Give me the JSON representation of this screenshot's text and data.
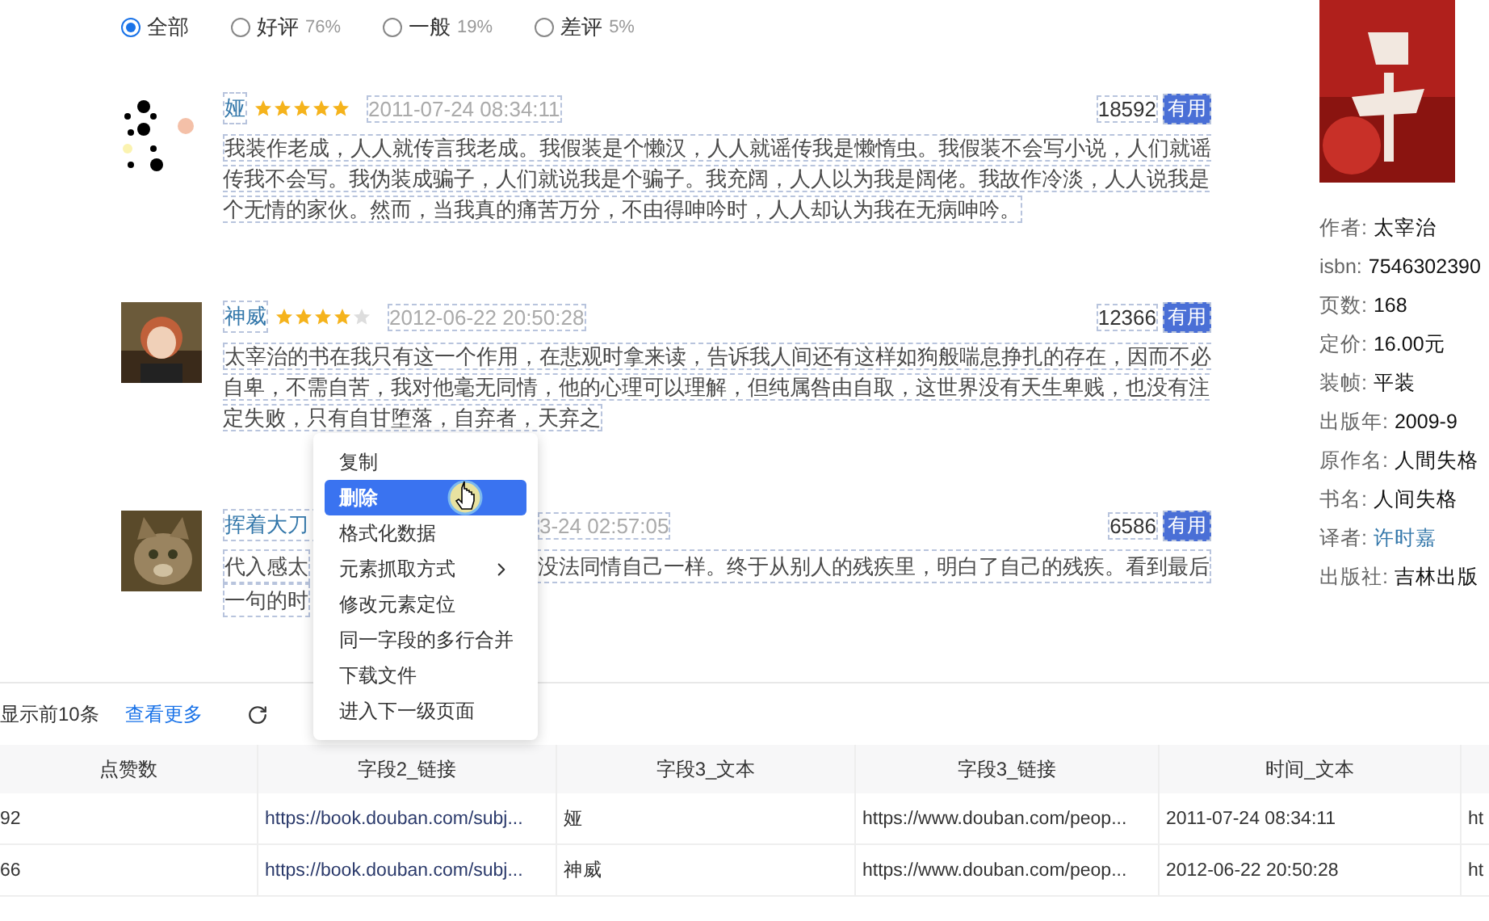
{
  "filter": [
    {
      "label": "全部",
      "selected": true
    },
    {
      "label": "好评",
      "share": "76%",
      "selected": false
    },
    {
      "label": "一般",
      "share": "19%",
      "selected": false
    },
    {
      "label": "差评",
      "share": "5%",
      "selected": false
    }
  ],
  "reviews": [
    {
      "kind": "full",
      "user": "娅",
      "stars": 5,
      "date": "2011-07-24 08:34:11",
      "useful_count": "18592",
      "useful_label": "有用",
      "text": "我装作老成，人人就传言我老成。我假装是个懒汉，人人就谣传我是懒惰虫。我假装不会写小说，人们就谣传我不会写。我伪装成骗子，人们就说我是个骗子。我充阔，人人以为我是阔佬。我故作冷淡，人人说我是个无情的家伙。然而，当我真的痛苦万分，不由得呻吟时，人人却认为我在无病呻吟。"
    },
    {
      "kind": "full",
      "user": "神威",
      "stars": 4,
      "date": "2012-06-22 20:50:28",
      "useful_count": "12366",
      "useful_label": "有用",
      "text": "太宰治的书在我只有这一个作用，在悲观时拿来读，告诉我人间还有这样如狗般喘息挣扎的存在，因而不必自卑，不需自苦，我对他毫无同情，他的心理可以理解，但纯属咎由自取，这世界没有天生卑贱，也没有注定失败，只有自甘堕落，自弃者，天弃之"
    },
    {
      "kind": "covered",
      "user": "挥着大刀",
      "date": "3-24 02:57:05",
      "useful_count": "6586",
      "useful_label": "有用",
      "text_start": "代入感太",
      "text_end": "没法同情自己一样。终于从别人的残疾里，明白了自己的残疾。看到最后",
      "text_line_2": "一句的时"
    }
  ],
  "book": {
    "info": [
      {
        "label": "作者:",
        "value": "太宰治",
        "link": false
      },
      {
        "label": "isbn:",
        "value": "7546302390",
        "link": false
      },
      {
        "label": "页数:",
        "value": "168",
        "link": false
      },
      {
        "label": "定价:",
        "value": "16.00元",
        "link": false
      },
      {
        "label": "装帧:",
        "value": "平装",
        "link": false
      },
      {
        "label": "出版年:",
        "value": "2009-9",
        "link": false
      },
      {
        "label": "原作名:",
        "value": "人間失格",
        "link": false
      },
      {
        "label": "书名:",
        "value": "人间失格",
        "link": false
      },
      {
        "label": "译者:",
        "value": "许时嘉",
        "link": true
      },
      {
        "label": "出版社:",
        "value": "吉林出版",
        "link": false
      }
    ]
  },
  "context_menu": {
    "items": [
      {
        "label": "复制",
        "selected": false,
        "has_submenu": false
      },
      {
        "label": "删除",
        "selected": true,
        "has_submenu": false
      },
      {
        "label": "格式化数据",
        "selected": false,
        "has_submenu": false
      },
      {
        "label": "元素抓取方式",
        "selected": false,
        "has_submenu": true
      },
      {
        "label": "修改元素定位",
        "selected": false,
        "has_submenu": false
      },
      {
        "label": "同一字段的多行合并",
        "selected": false,
        "has_submenu": false
      },
      {
        "label": "下载文件",
        "selected": false,
        "has_submenu": false
      },
      {
        "label": "进入下一级页面",
        "selected": false,
        "has_submenu": false
      }
    ]
  },
  "toolbar": {
    "note": "显示前10条",
    "more_link": "查看更多"
  },
  "table": {
    "columns": [
      "点赞数",
      "字段2_链接",
      "字段3_文本",
      "字段3_链接",
      "时间_文本"
    ],
    "rows": [
      [
        "92",
        "https://book.douban.com/subj...",
        "娅",
        "https://www.douban.com/peop...",
        "2011-07-24 08:34:11",
        "ht"
      ],
      [
        "66",
        "https://book.douban.com/subj...",
        "神威",
        "https://www.douban.com/peop...",
        "2012-06-22 20:50:28",
        "ht"
      ]
    ]
  }
}
